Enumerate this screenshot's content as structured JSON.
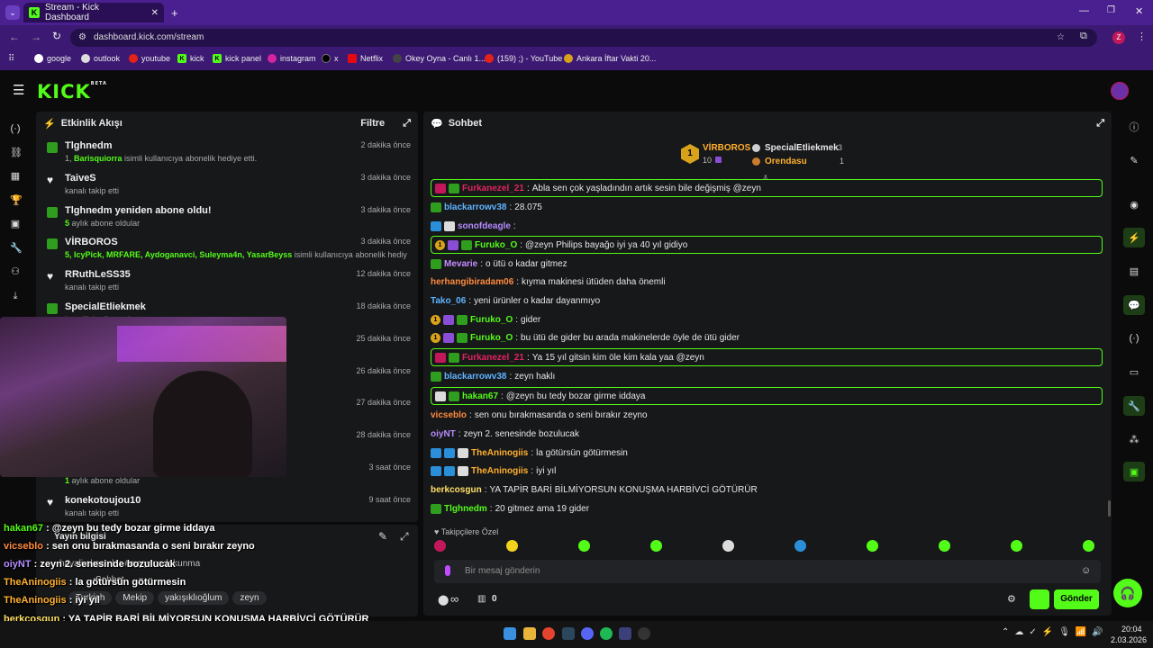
{
  "browser": {
    "tab_title": "Stream - Kick Dashboard",
    "url": "dashboard.kick.com/stream",
    "profile_letter": "Z",
    "bookmarks": [
      "google",
      "outlook",
      "youtube",
      "kick",
      "kick panel",
      "instagram",
      "x",
      "Netflix",
      "Okey Oyna - Canlı 1...",
      "(159) ;) - YouTube",
      "Ankara İftar Vakti 20..."
    ]
  },
  "kick": {
    "logo": "KICK",
    "beta": "BETA"
  },
  "activity": {
    "title": "Etkinlik Akışı",
    "filter_label": "Filtre",
    "events": [
      {
        "icon": "gift-icon",
        "name": "Tlghnedm",
        "detail_prefix": "1, ",
        "detail_users": "Barisquiorra",
        "detail_suffix": " isimli kullanıcıya abonelik hediye etti.",
        "time": "2 dakika önce"
      },
      {
        "icon": "heart-icon",
        "name": "TaiveS",
        "detail_prefix": "kanalı takip etti",
        "detail_users": "",
        "detail_suffix": "",
        "time": "3 dakika önce"
      },
      {
        "icon": "gift-icon",
        "name": "Tlghnedm yeniden abone oldu!",
        "detail_prefix": "",
        "detail_users": "5",
        "detail_suffix": " aylık abone oldular",
        "time": "3 dakika önce"
      },
      {
        "icon": "gift-icon",
        "name": "VİRBOROS",
        "detail_prefix": "",
        "detail_users": "5, IcyPick, MRFARE, Aydoganavci, Suleyma4n, YasarBeyss",
        "detail_suffix": " isimli kullanıcıya abonelik hediye etti.",
        "time": "3 dakika önce"
      },
      {
        "icon": "heart-icon",
        "name": "RRuthLeSS35",
        "detail_prefix": "kanalı takip etti",
        "detail_users": "",
        "detail_suffix": "",
        "time": "12 dakika önce"
      },
      {
        "icon": "gift-icon",
        "name": "SpecialEtliekmek",
        "detail_prefix": "",
        "detail_users": "",
        "detail_suffix": "bonelik hediye etti.",
        "time": "18 dakika önce"
      },
      {
        "icon": "",
        "name": "",
        "detail_prefix": "",
        "detail_users": "",
        "detail_suffix": "",
        "time": "25 dakika önce"
      },
      {
        "icon": "",
        "name": "",
        "detail_prefix": "",
        "detail_users": "",
        "detail_suffix": "",
        "time": "26 dakika önce"
      },
      {
        "icon": "",
        "name": "",
        "detail_prefix": "",
        "detail_users": "",
        "detail_suffix": "",
        "time": "27 dakika önce"
      },
      {
        "icon": "",
        "name": "",
        "detail_prefix": "",
        "detail_users": "",
        "detail_suffix": "",
        "time": "28 dakika önce"
      },
      {
        "icon": "",
        "name": "",
        "detail_prefix": "",
        "detail_users": "1",
        "detail_suffix": " aylık abone oldular",
        "time": "3 saat önce"
      },
      {
        "icon": "heart-icon",
        "name": "konekotoujou10",
        "detail_prefix": "kanalı takip etti",
        "detail_users": "",
        "detail_suffix": "",
        "time": "9 saat önce"
      }
    ]
  },
  "stream_info": {
    "title": "Yayın bilgisi",
    "line1": "hayali akşamlar #ayyy4nadokunma",
    "line2": "Sohbet",
    "tags": [
      "Turkish",
      "Mekip",
      "yakışıklıoğlum",
      "zeyn"
    ]
  },
  "chat": {
    "title": "Sohbet",
    "leaderboard": {
      "first_name": "VİRBOROS",
      "first_count": "10",
      "rank": "1",
      "second_name": "SpecialEtliekmek",
      "second_count": "3",
      "third_name": "Orendasu",
      "third_count": "1"
    },
    "messages": [
      {
        "user": "Furkanezel_21",
        "color": "#e0245e",
        "text": "Abla sen çok yaşladındın artık sesin bile değişmiş @zeyn",
        "hl": true
      },
      {
        "user": "blackarrowv38",
        "color": "#5fb3ff",
        "text": "28.075",
        "hl": false
      },
      {
        "user": "sonofdeagle",
        "color": "#b48cff",
        "text": "",
        "hl": false
      },
      {
        "user": "Furuko_O",
        "color": "#53fc18",
        "text": "@zeyn Philips bayağo iyi ya 40 yıl gidiyo",
        "hl": true
      },
      {
        "user": "Mevarie",
        "color": "#c58cff",
        "text": "o ütü o kadar gitmez",
        "hl": false
      },
      {
        "user": "herhangibiradam06",
        "color": "#ff8a3d",
        "text": "kıyma makinesi ütüden daha önemli",
        "hl": false
      },
      {
        "user": "Tako_06",
        "color": "#5fb3ff",
        "text": "yeni ürünler o kadar dayanmıyo",
        "hl": false
      },
      {
        "user": "Furuko_O",
        "color": "#53fc18",
        "text": "gider",
        "hl": false
      },
      {
        "user": "Furuko_O",
        "color": "#53fc18",
        "text": "bu ütü de gider bu arada makinelerde öyle de ütü gider",
        "hl": false
      },
      {
        "user": "Furkanezel_21",
        "color": "#e0245e",
        "text": "Ya 15 yıl gitsin kim öle kim kala yaa @zeyn",
        "hl": true
      },
      {
        "user": "blackarrowv38",
        "color": "#5fb3ff",
        "text": "zeyn haklı",
        "hl": false
      },
      {
        "user": "hakan67",
        "color": "#53fc18",
        "text": "@zeyn bu tedy bozar girme iddaya",
        "hl": true
      },
      {
        "user": "vicseblo",
        "color": "#ff8a3d",
        "text": "sen onu bırakmasanda o seni bırakır zeyno",
        "hl": false
      },
      {
        "user": "oiyNT",
        "color": "#b48cff",
        "text": "zeyn 2. senesinde bozulucak",
        "hl": false
      },
      {
        "user": "TheAninogiis",
        "color": "#ffb02e",
        "text": "la götürsün götürmesin",
        "hl": false
      },
      {
        "user": "TheAninogiis",
        "color": "#ffb02e",
        "text": "iyi yıl",
        "hl": false
      },
      {
        "user": "berkcosgun",
        "color": "#ffe066",
        "text": "YA TAPİR BARİ BİLMİYORSUN KONUŞMA HARBİVCİ GÖTÜRÜR",
        "hl": false
      },
      {
        "user": "Tlghnedm",
        "color": "#53fc18",
        "text": "20 gitmez ama 19 gider",
        "hl": false
      }
    ],
    "emote_section": "Takipçilere Özel",
    "input_placeholder": "Bir mesaj gönderin",
    "send_label": "Gönder",
    "infinity": "∞",
    "drops_count": "0"
  },
  "overlay": [
    {
      "user": "hakan67",
      "text": " : @zeyn bu tedy bozar girme iddaya",
      "color": "#53fc18"
    },
    {
      "user": "vicseblo",
      "text": " : sen onu bırakmasanda o seni bırakır zeyno",
      "color": "#ff8a3d"
    },
    {
      "user": "oiyNT",
      "text": " : zeyn 2. senesinde bozulucak",
      "color": "#b48cff"
    },
    {
      "user": "TheAninogiis",
      "text": " : la götürsün götürmesin",
      "color": "#ffb02e"
    },
    {
      "user": "TheAninogiis",
      "text": " : iyi yıl",
      "color": "#ffb02e"
    },
    {
      "user": "berkcosgun",
      "text": " : YA TAPİR BARİ BİLMİYORSUN KONUŞMA HARBİVCİ GÖTÜRÜR",
      "color": "#ffe066"
    },
    {
      "user": "Tlghnedm",
      "text": " : 20 gitmez ama 19 gider",
      "color": "#5fb3ff"
    }
  ],
  "clock": {
    "time": "20:04",
    "date": "2.03.2026"
  }
}
